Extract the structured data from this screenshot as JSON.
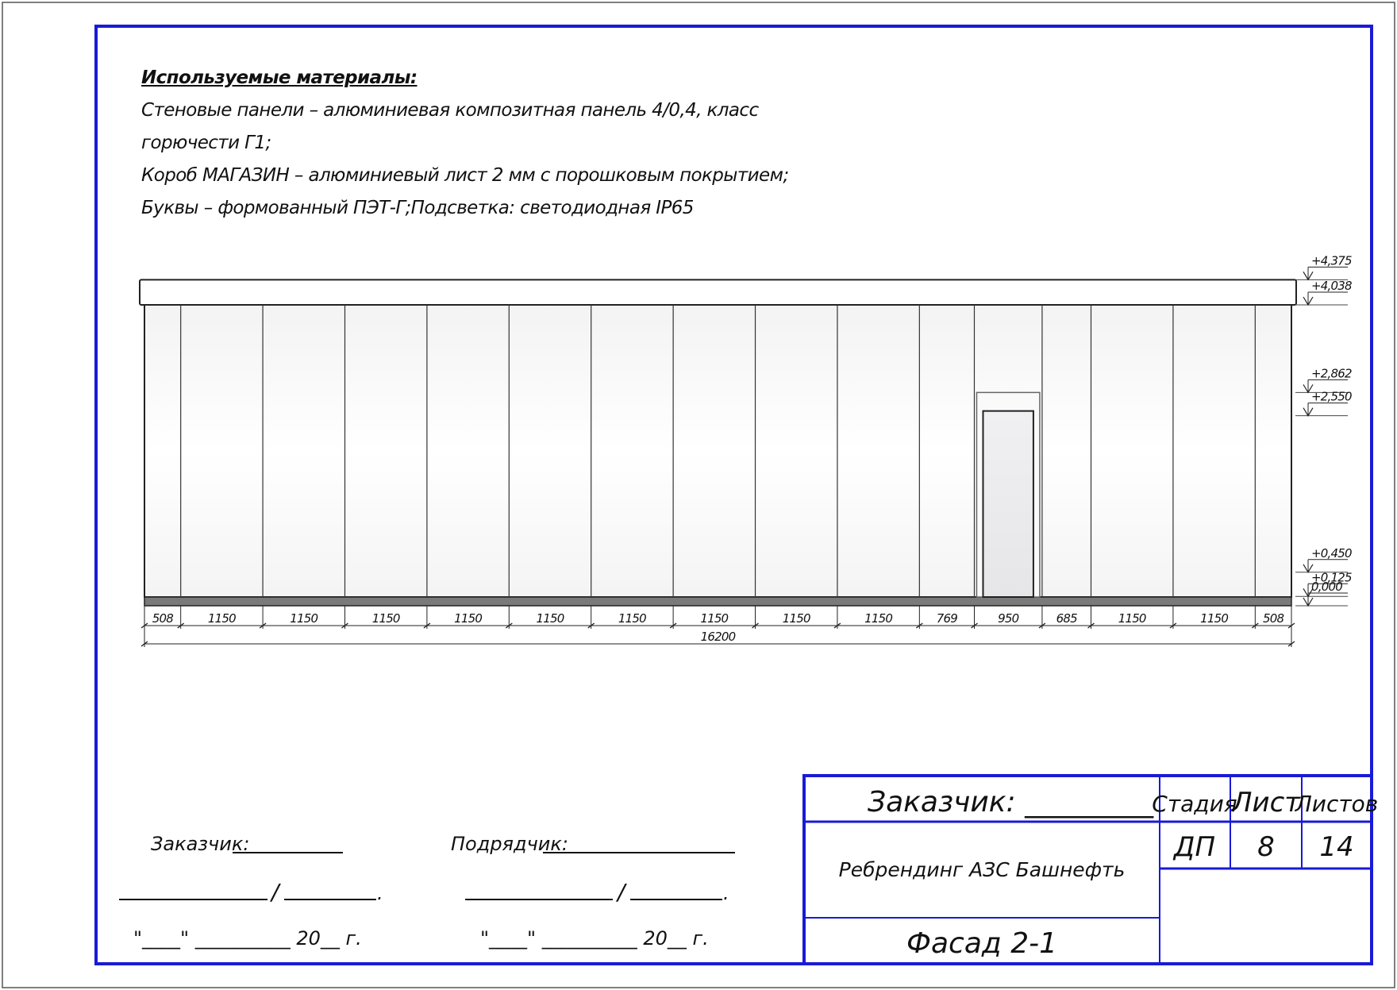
{
  "materials": {
    "heading": "Используемые материалы:",
    "lines": [
      "Стеновые панели – алюминиевая композитная панель 4/0,4, класс",
      "горючести Г1;",
      "Короб МАГАЗИН – алюминиевый лист 2 мм с порошковым покрытием;",
      "Буквы – формованный ПЭТ-Г;Подсветка: светодиодная IP65"
    ]
  },
  "facade": {
    "panel_widths": [
      508,
      1150,
      1150,
      1150,
      1150,
      1150,
      1150,
      1150,
      1150,
      1150,
      769,
      950,
      685,
      1150,
      1150,
      508
    ],
    "panel_labels": [
      "508",
      "1150",
      "1150",
      "1150",
      "1150",
      "1150",
      "1150",
      "1150",
      "1150",
      "1150",
      "769",
      "950",
      "685",
      "1150",
      "1150",
      "508"
    ],
    "total_label": "16200",
    "levels": [
      {
        "value": 4.375,
        "label": "+4,375"
      },
      {
        "value": 4.038,
        "label": "+4,038"
      },
      {
        "value": 2.862,
        "label": "+2,862"
      },
      {
        "value": 2.55,
        "label": "+2,550"
      },
      {
        "value": 0.45,
        "label": "+0,450"
      },
      {
        "value": 0.125,
        "label": "+0,125"
      },
      {
        "value": 0.0,
        "label": "0,000"
      }
    ]
  },
  "signatures": {
    "customer_label": "Заказчик:",
    "contractor_label": "Подрядчик:",
    "date_left": "\"____\" __________ 20__ г.",
    "date_right": "\"____\" __________ 20__ г.",
    "slash": "/",
    "dot": "."
  },
  "title_block": {
    "customer": "Заказчик: _________",
    "stage_header": "Стадия",
    "sheet_header": "Лист",
    "sheets_header": "Листов",
    "stage": "ДП",
    "sheet": "8",
    "sheets": "14",
    "project": "Ребрендинг АЗС Башнефть",
    "drawing": "Фасад 2-1"
  },
  "colors": {
    "frame_blue": "#1a1ad6",
    "outline": "#222222",
    "ground": "#7a7a7a"
  }
}
